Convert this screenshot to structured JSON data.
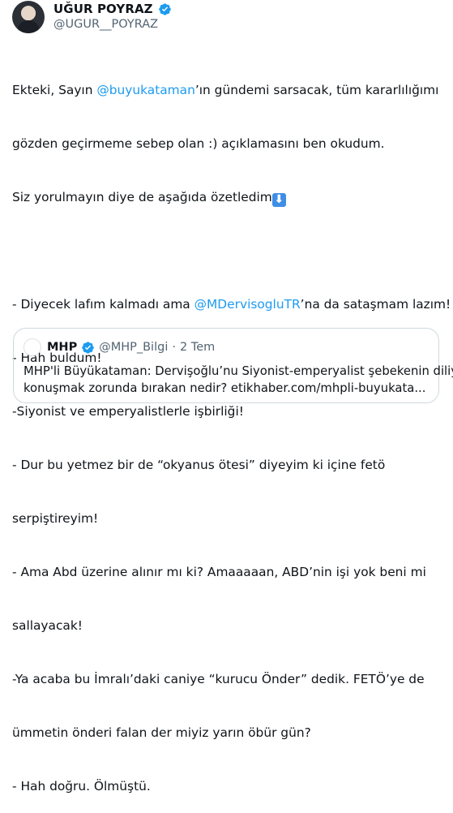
{
  "author": {
    "name": "UĞUR POYRAZ",
    "handle": "@UGUR__POYRAZ"
  },
  "tweet": {
    "lines": [
      [
        "Ekteki, Sayın ",
        "@buyukataman",
        "’ın gündemi sarsacak, tüm kararlılığımı"
      ],
      [
        "gözden geçirmeme sebep olan :) açıklamasını ben okudum."
      ],
      [
        "Siz yorulmayın diye de aşağıda özetledim"
      ],
      [
        ""
      ],
      [
        "- Diyecek lafım kalmadı ama ",
        "@MDervisogluTR",
        "’na da sataşmam lazım!"
      ],
      [
        "- Hah buldum!"
      ],
      [
        "-Siyonist ve emperyalistlerle işbirliği!"
      ],
      [
        "- Dur bu yetmez bir de “okyanus ötesi” diyeyim ki içine fetö"
      ],
      [
        "serpiştireyim!"
      ],
      [
        "- Ama Abd üzerine alınır mı ki? Amaaaaan, ABD’nin işi yok beni mi"
      ],
      [
        "sallayacak!"
      ],
      [
        "-Ya acaba bu İmralı’daki caniye “kurucu Önder” dedik. FETÖ’ye de"
      ],
      [
        "ümmetin önderi falan der miyiz yarın öbür gün?"
      ],
      [
        "- Hah doğru. Ölmüştü."
      ]
    ],
    "emoji_arrow": "⬇"
  },
  "quote": {
    "name": "MHP",
    "handle": "@MHP_Bilgi",
    "separator": "·",
    "time": "2 Tem",
    "line1": "MHP'li Büyükataman: Dervişoğlu’nu Siyonist-emperyalist şebekenin diliyle",
    "line2": "konuşmak zorunda bırakan nedir? etikhaber.com/mhpli-buyukata..."
  },
  "colors": {
    "verified": "#1d9bf0",
    "mention": "#1d9bf0",
    "mhp_red": "#e30a17"
  }
}
